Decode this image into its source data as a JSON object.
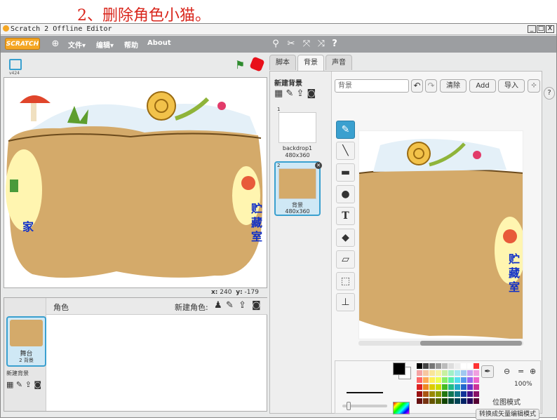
{
  "slide_title": "2、删除角色小猫。",
  "window": {
    "title": "Scratch 2 Offline Editor",
    "minimize": "_",
    "maximize": "□",
    "close": "X"
  },
  "menubar": {
    "logo": "SCRATCH",
    "items": [
      {
        "label": "文件▾",
        "name": "menu-file"
      },
      {
        "label": "编辑▾",
        "name": "menu-edit"
      },
      {
        "label": "帮助",
        "name": "menu-help"
      },
      {
        "label": "About",
        "name": "menu-about"
      }
    ]
  },
  "stage": {
    "version": "v424",
    "coords_x_label": "x:",
    "coords_x": "240",
    "coords_y_label": "y:",
    "coords_y": "-179",
    "label_home": "家",
    "label_storage": "贮藏室"
  },
  "sprites": {
    "header": "角色",
    "new_sprite": "新建角色:",
    "stage_thumb": {
      "title": "舞台",
      "subtitle": "2 背景"
    },
    "new_backdrop": "新建背景"
  },
  "tabs": [
    {
      "label": "脚本",
      "active": false
    },
    {
      "label": "背景",
      "active": true
    },
    {
      "label": "声音",
      "active": false
    }
  ],
  "backdrops": {
    "new_label": "新建背景",
    "items": [
      {
        "index": "1",
        "name": "backdrop1",
        "size": "480x360"
      },
      {
        "index": "2",
        "name": "背景",
        "size": "480x360"
      }
    ]
  },
  "editor": {
    "name_value": "背景",
    "clear": "清除",
    "add": "Add",
    "import": "导入",
    "zoom_pct": "100%",
    "mode": "位图模式",
    "convert": "转换成矢量编辑模式"
  },
  "colors": {
    "brand_orange": "#f5a623",
    "menubar": "#9c9ea1",
    "selected": "#3aa0cf",
    "title_red": "#d9261c",
    "label_blue": "#1030c8"
  },
  "palette": [
    "#000000",
    "#444444",
    "#777777",
    "#999999",
    "#bbbbbb",
    "#dddddd",
    "#eeeeee",
    "#ffffff",
    "#ffffff",
    "#ff3333",
    "#f4a3a3",
    "#f7c6a0",
    "#f9e59a",
    "#f7f3a0",
    "#c8f0a0",
    "#a0f0c8",
    "#a0e8f0",
    "#a0c8f0",
    "#c8a0f0",
    "#f0a0e0",
    "#ff6666",
    "#ffaa55",
    "#ffee55",
    "#eeff55",
    "#88ee66",
    "#55eeaa",
    "#55ddee",
    "#5599ee",
    "#9966ee",
    "#ee66cc",
    "#dd2222",
    "#ee8822",
    "#ddcc00",
    "#ccdd00",
    "#44bb22",
    "#22bb88",
    "#22aacc",
    "#2266cc",
    "#6633cc",
    "#cc3399",
    "#991111",
    "#aa5511",
    "#998800",
    "#889900",
    "#227711",
    "#117755",
    "#117788",
    "#113399",
    "#441188",
    "#881166",
    "#661111",
    "#773311",
    "#665500",
    "#556600",
    "#114400",
    "#004433",
    "#004455",
    "#002266",
    "#220055",
    "#550033"
  ]
}
